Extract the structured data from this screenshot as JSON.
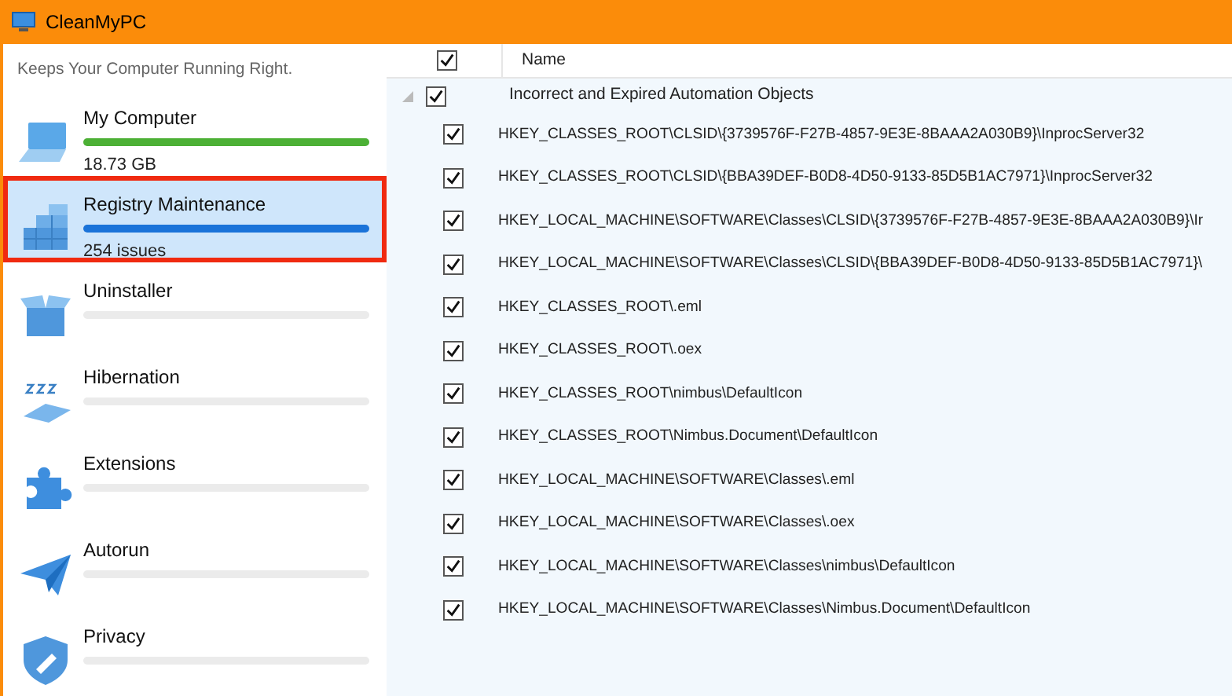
{
  "window": {
    "title": "CleanMyPC"
  },
  "sidebar": {
    "tagline": "Keeps Your Computer Running Right.",
    "items": [
      {
        "kind": "computer",
        "label": "My Computer",
        "level": 1,
        "color": "#4cb035",
        "detail": "18.73 GB",
        "selected": false
      },
      {
        "kind": "registry",
        "label": "Registry Maintenance",
        "level": 1,
        "color": "#1a73d9",
        "detail": "254 issues",
        "selected": true
      },
      {
        "kind": "uninstaller",
        "label": "Uninstaller",
        "selected": false
      },
      {
        "kind": "hibernation",
        "label": "Hibernation",
        "selected": false
      },
      {
        "kind": "extensions",
        "label": "Extensions",
        "selected": false
      },
      {
        "kind": "autorun",
        "label": "Autorun",
        "selected": false
      },
      {
        "kind": "privacy",
        "label": "Privacy",
        "selected": false
      }
    ]
  },
  "table": {
    "header": {
      "checked": true,
      "name": "Name"
    },
    "group": {
      "label": "Incorrect and Expired Automation Objects",
      "checked": true,
      "expanded": true,
      "rows": [
        {
          "name": "HKEY_CLASSES_ROOT\\CLSID\\{3739576F-F27B-4857-9E3E-8BAAA2A030B9}\\InprocServer32",
          "checked": true
        },
        {
          "name": "HKEY_CLASSES_ROOT\\CLSID\\{BBA39DEF-B0D8-4D50-9133-85D5B1AC7971}\\InprocServer32",
          "checked": true
        },
        {
          "name": "HKEY_LOCAL_MACHINE\\SOFTWARE\\Classes\\CLSID\\{3739576F-F27B-4857-9E3E-8BAAA2A030B9}\\Ir",
          "checked": true
        },
        {
          "name": "HKEY_LOCAL_MACHINE\\SOFTWARE\\Classes\\CLSID\\{BBA39DEF-B0D8-4D50-9133-85D5B1AC7971}\\",
          "checked": true
        },
        {
          "name": "HKEY_CLASSES_ROOT\\.eml",
          "checked": true
        },
        {
          "name": "HKEY_CLASSES_ROOT\\.oex",
          "checked": true
        },
        {
          "name": "HKEY_CLASSES_ROOT\\nimbus\\DefaultIcon",
          "checked": true
        },
        {
          "name": "HKEY_CLASSES_ROOT\\Nimbus.Document\\DefaultIcon",
          "checked": true
        },
        {
          "name": "HKEY_LOCAL_MACHINE\\SOFTWARE\\Classes\\.eml",
          "checked": true
        },
        {
          "name": "HKEY_LOCAL_MACHINE\\SOFTWARE\\Classes\\.oex",
          "checked": true
        },
        {
          "name": "HKEY_LOCAL_MACHINE\\SOFTWARE\\Classes\\nimbus\\DefaultIcon",
          "checked": true
        },
        {
          "name": "HKEY_LOCAL_MACHINE\\SOFTWARE\\Classes\\Nimbus.Document\\DefaultIcon",
          "checked": true
        }
      ]
    }
  }
}
